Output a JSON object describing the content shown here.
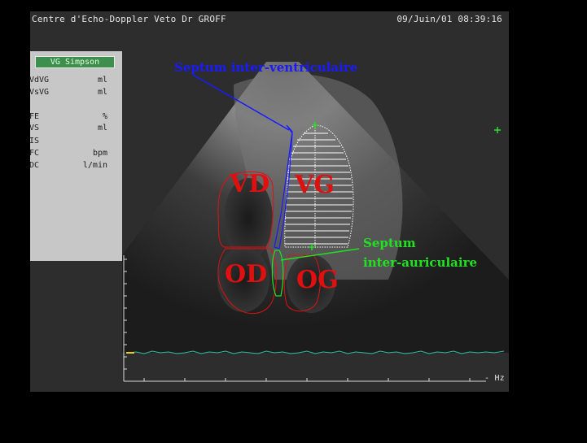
{
  "header": {
    "left": "Centre d'Echo-Doppler Veto Dr GROFF",
    "right": "09/Juin/01 08:39:16"
  },
  "measure_panel": {
    "title": "VG Simpson",
    "rows": [
      {
        "label": "VdVG",
        "unit": "ml"
      },
      {
        "label": "VsVG",
        "unit": "ml"
      },
      {
        "label": "FE",
        "unit": "%"
      },
      {
        "label": "VS",
        "unit": "ml"
      },
      {
        "label": "IS",
        "unit": ""
      },
      {
        "label": "FC",
        "unit": "bpm"
      },
      {
        "label": "DC",
        "unit": "l/min"
      }
    ]
  },
  "annotations": {
    "septum_iv": "Septum inter-ventriculaire",
    "vd": "VD",
    "vg": "VG",
    "od": "OD",
    "og": "OG",
    "septum_ia_line1": "Septum",
    "septum_ia_line2": "inter-auriculaire"
  },
  "scale": {
    "right_label": "- Hz"
  },
  "colors": {
    "septum_iv": "#1a1aff",
    "chambers": "#e01010",
    "septum_ia": "#22e022",
    "ecg": "#2fbf9f",
    "tracing": "#ffffff"
  }
}
